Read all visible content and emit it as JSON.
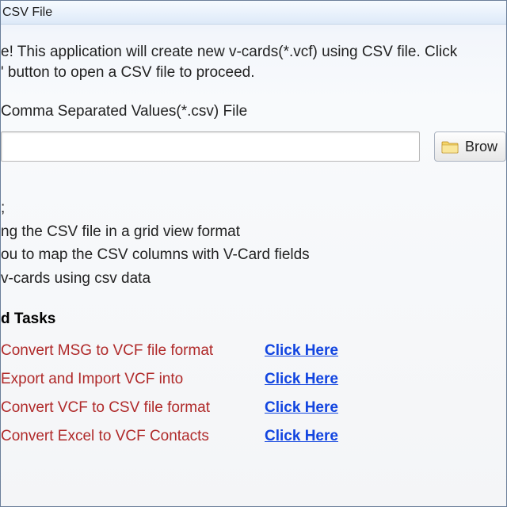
{
  "window": {
    "title": " CSV File"
  },
  "welcome": {
    "line1": "e! This application will create new v-cards(*.vcf) using CSV file. Click",
    "line2": "' button to open a CSV file to proceed."
  },
  "file": {
    "heading": "Comma Separated Values(*.csv)  File",
    "path_value": "",
    "browse_label": "Brow",
    "folder_icon": "folder-icon"
  },
  "steps": {
    "line0": ";",
    "line1": "ng the CSV file in a grid view format",
    "line2": "ou to map the CSV columns with V-Card fields",
    "line3": "v-cards using csv data"
  },
  "related": {
    "header": "d Tasks",
    "items": [
      {
        "label": "Convert MSG to VCF file format",
        "link": "Click Here"
      },
      {
        "label": "Export and Import VCF into",
        "link": "Click Here"
      },
      {
        "label": "Convert VCF to CSV file format",
        "link": "Click Here"
      },
      {
        "label": "Convert Excel to VCF Contacts",
        "link": "Click Here"
      }
    ]
  }
}
